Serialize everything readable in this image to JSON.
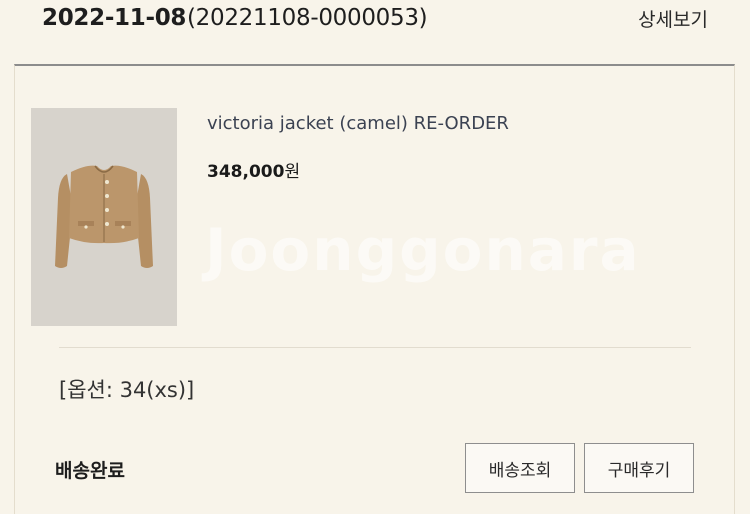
{
  "order": {
    "date": "2022-11-08",
    "number": "(20221108-0000053)",
    "detail_link": "상세보기"
  },
  "product": {
    "name": "victoria jacket (camel) RE-ORDER",
    "price_amount": "348,000",
    "price_unit": "원",
    "option": "[옵션: 34(xs)]",
    "watermark": "Joonggonara"
  },
  "delivery": {
    "status": "배송완료",
    "track_button": "배송조회",
    "review_button": "구매후기"
  },
  "colors": {
    "background": "#f8f4ea",
    "product_name": "#3b4252",
    "jacket": "#b8946a"
  }
}
